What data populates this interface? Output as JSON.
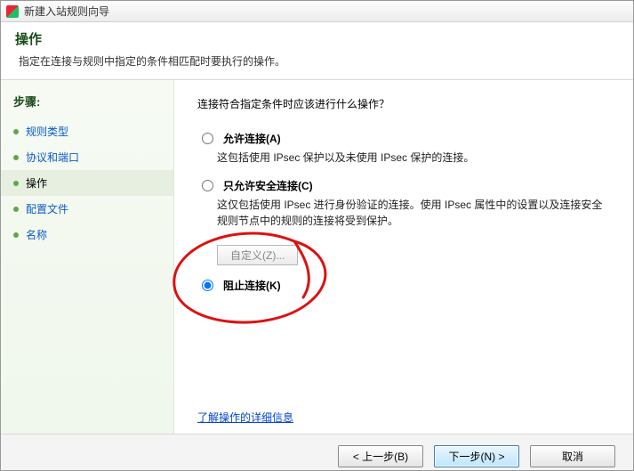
{
  "window": {
    "title": "新建入站规则向导"
  },
  "header": {
    "title": "操作",
    "subtitle": "指定在连接与规则中指定的条件相匹配时要执行的操作。"
  },
  "sidebar": {
    "steps_label": "步骤:",
    "items": [
      {
        "label": "规则类型",
        "active": false
      },
      {
        "label": "协议和端口",
        "active": false
      },
      {
        "label": "操作",
        "active": true
      },
      {
        "label": "配置文件",
        "active": false
      },
      {
        "label": "名称",
        "active": false
      }
    ]
  },
  "content": {
    "prompt": "连接符合指定条件时应该进行什么操作？",
    "options": [
      {
        "id": "allow",
        "label": "允许连接(A)",
        "desc": "这包括使用 IPsec 保护以及未使用 IPsec 保护的连接。",
        "checked": false
      },
      {
        "id": "allow-secure",
        "label": "只允许安全连接(C)",
        "desc": "这仅包括使用 IPsec 进行身份验证的连接。使用 IPsec 属性中的设置以及连接安全规则节点中的规则的连接将受到保护。",
        "checked": false
      },
      {
        "id": "block",
        "label": "阻止连接(K)",
        "desc": "",
        "checked": true
      }
    ],
    "customize_label": "自定义(Z)...",
    "learn_more": "了解操作的详细信息"
  },
  "footer": {
    "back": "< 上一步(B)",
    "next": "下一步(N) >",
    "cancel": "取消"
  }
}
